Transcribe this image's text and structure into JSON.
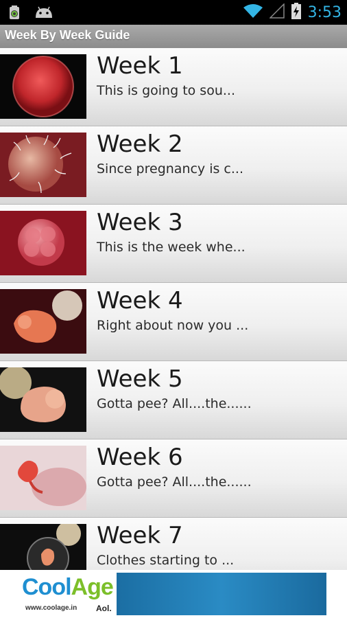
{
  "status_bar": {
    "time": "3:53",
    "icons": [
      "battery-saver-icon",
      "android-icon",
      "wifi-icon",
      "signal-icon",
      "battery-charging-icon"
    ],
    "accent_color": "#33b5e5"
  },
  "header": {
    "title": "Week By Week Guide"
  },
  "weeks": [
    {
      "title": "Week 1",
      "desc": "This is going to sou..."
    },
    {
      "title": "Week 2",
      "desc": "Since pregnancy is c..."
    },
    {
      "title": "Week 3",
      "desc": "This is the week whe..."
    },
    {
      "title": "Week 4",
      "desc": "Right about now you ..."
    },
    {
      "title": "Week 5",
      "desc": "Gotta pee? All....the......"
    },
    {
      "title": "Week 6",
      "desc": "Gotta pee? All....the......"
    },
    {
      "title": "Week 7",
      "desc": "Clothes starting to ..."
    }
  ],
  "ad": {
    "brand_part1": "Cool",
    "brand_part2": "Age",
    "url": "www.coolage.in",
    "partner": "Aol."
  }
}
